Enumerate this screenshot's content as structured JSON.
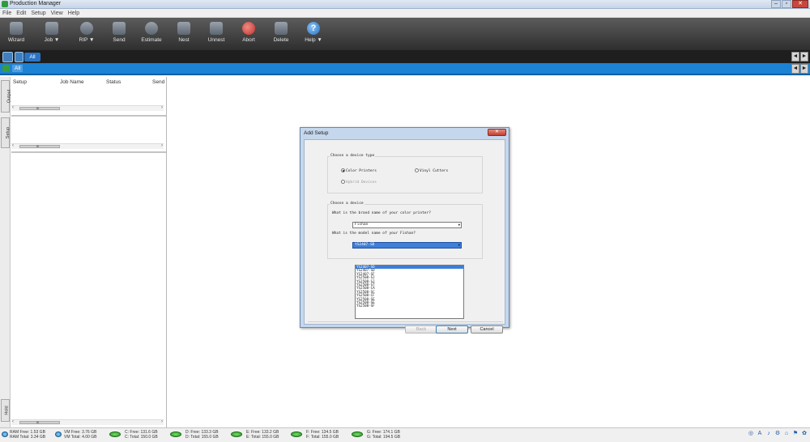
{
  "window": {
    "title": "Production Manager",
    "controls": [
      "–",
      "▫",
      "✕"
    ]
  },
  "menubar": [
    "File",
    "Edit",
    "Setup",
    "View",
    "Help"
  ],
  "toolbar": [
    {
      "label": "Wizard",
      "icon": "wizard-icon"
    },
    {
      "label": "Job ▼",
      "icon": "job-icon"
    },
    {
      "label": "RIP ▼",
      "icon": "rip-icon"
    },
    {
      "label": "Send",
      "icon": "send-icon"
    },
    {
      "label": "Estimate",
      "icon": "estimate-icon"
    },
    {
      "label": "Nest",
      "icon": "nest-icon"
    },
    {
      "label": "Unnest",
      "icon": "unnest-icon"
    },
    {
      "label": "Abort",
      "icon": "abort-icon"
    },
    {
      "label": "Delete",
      "icon": "delete-icon"
    },
    {
      "label": "Help ▼",
      "icon": "help-icon"
    }
  ],
  "help_glyph": "?",
  "tabs": {
    "all": "All"
  },
  "filter": {
    "all": "All"
  },
  "nav_arrows": {
    "left": "◄",
    "right": "►"
  },
  "left_panel": {
    "columns": [
      "Setup",
      "Job Name",
      "Status",
      "Send"
    ],
    "vtabs": [
      "Output",
      "Setup",
      "Hold"
    ],
    "scroll_thumb": "III"
  },
  "status": {
    "ram": "RAM Free: 1.53 GB\nRAM Total: 3.34 GB",
    "vm": "VM Free: 3.76 GB\nVM Total: 4.00 GB",
    "disks": [
      "C: Free: 131.6 GB\nC: Total: 150.0 GB",
      "D: Free: 133.3 GB\nD: Total: 155.0 GB",
      "E: Free: 133.2 GB\nE: Total: 155.0 GB",
      "F: Free: 134.5 GB\nF: Total: 155.0 GB",
      "G: Free: 174.1 GB\nG: Total: 194.5 GB"
    ]
  },
  "dialog": {
    "title": "Add Setup",
    "close": "✕",
    "group_device_type": "Choose a device type",
    "device_types": [
      {
        "label": "Color Printers",
        "selected": true,
        "enabled": true
      },
      {
        "label": "Vinyl Cutters",
        "selected": false,
        "enabled": true
      },
      {
        "label": "Hybrid Devices",
        "selected": false,
        "enabled": false
      }
    ],
    "group_device": "Choose a device",
    "brand_question": "What is the brand name of your color printer?",
    "brand_value": "Fishan",
    "model_question": "What is the model name of your Fishan?",
    "model_value": "YS2407-SD",
    "model_options": [
      "YS2407-SD",
      "YS2407-SD",
      "YS2407-SF",
      "YS2508-SJ",
      "YS2508-SJ",
      "YS2508-ST",
      "YS2508-CA",
      "YS2508-SC",
      "YS2508-CF",
      "YS2508-SE",
      "YS2508-SE",
      "YS2508-SF"
    ],
    "buttons": {
      "back": "Back",
      "next": "Next",
      "cancel": "Cancel"
    }
  }
}
